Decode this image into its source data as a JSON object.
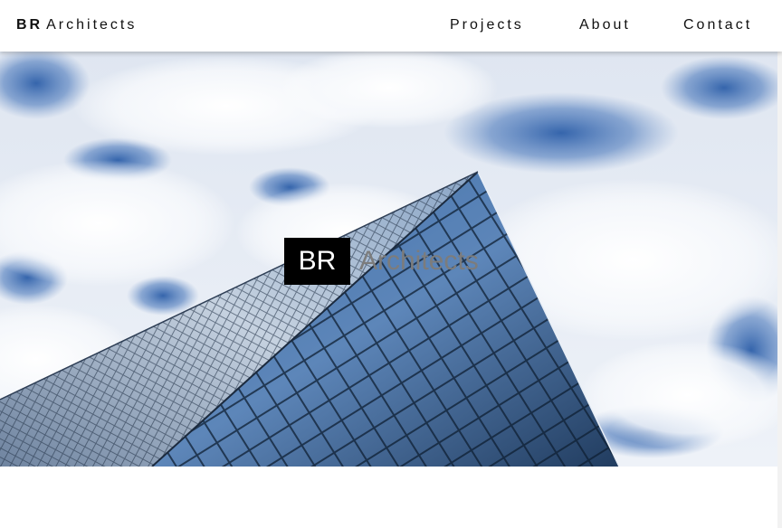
{
  "header": {
    "logo_bold": "BR",
    "logo_rest": "Architects",
    "nav": [
      {
        "label": "Projects"
      },
      {
        "label": "About"
      },
      {
        "label": "Contact"
      }
    ]
  },
  "hero": {
    "title_boxed": "BR",
    "title_rest": "Architects",
    "image": "glass-skyscraper-against-cloudy-sky"
  },
  "colors": {
    "nav_text": "#111111",
    "title_box": "#000000",
    "title_text": "#7c7c7c",
    "sky_blue": "#2f5fa8"
  }
}
